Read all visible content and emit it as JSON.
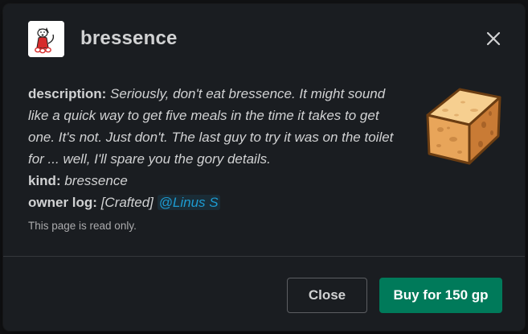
{
  "header": {
    "title": "bressence"
  },
  "details": {
    "description_label": "description:",
    "description_text": "Seriously, don't eat bressence. It might sound like a quick way to get five meals in the time it takes to get one. It's not. Just don't. The last guy to try it was on the toilet for ... well, I'll spare you the gory details.",
    "kind_label": "kind:",
    "kind_value": "bressence",
    "owner_log_label": "owner log:",
    "owner_log_prefix": "[Crafted]",
    "owner_log_mention": "@Linus S",
    "readonly_note": "This page is read only."
  },
  "footer": {
    "close_label": "Close",
    "buy_label": "Buy for 150 gp"
  },
  "icons": {
    "close": "close-icon",
    "avatar": "cartoon-dog-avatar",
    "item": "sponge-cake-cube"
  },
  "colors": {
    "modal_bg": "#1a1d21",
    "text": "#d1d2d3",
    "mention": "#1d9bd1",
    "buy_button": "#007a5a"
  }
}
